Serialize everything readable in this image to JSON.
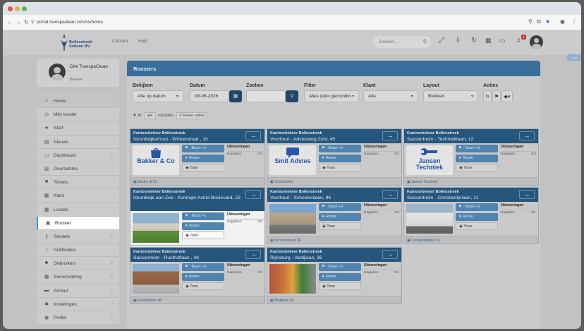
{
  "browser": {
    "url": "portal.transpaclean.nl/cms/home"
  },
  "topnav": {
    "logo_text": "Bollenstreek Schoon BV.",
    "links": [
      "Contact",
      "Help"
    ],
    "search_placeholder": "Zoeken...",
    "notification_count": "1"
  },
  "profile": {
    "name": "Dirk TranspaClean",
    "role": "Beheer"
  },
  "menu": [
    {
      "label": "Home",
      "icon": "home-icon",
      "chevron": false
    },
    {
      "label": "Mijn locatie",
      "icon": "globe-icon",
      "chevron": false
    },
    {
      "label": "Start",
      "icon": "star-icon",
      "chevron": false
    },
    {
      "label": "Nieuws",
      "icon": "news-icon",
      "chevron": false
    },
    {
      "label": "Dashboard",
      "icon": "chart-icon",
      "chevron": true
    },
    {
      "label": "Overzichten",
      "icon": "document-icon",
      "chevron": true
    },
    {
      "label": "Tickets",
      "icon": "chat-icon",
      "chevron": false
    },
    {
      "label": "Klant",
      "icon": "building-icon",
      "chevron": false
    },
    {
      "label": "Locatie",
      "icon": "building-icon",
      "chevron": false
    },
    {
      "label": "Rooster",
      "icon": "calendar-icon",
      "chevron": false
    },
    {
      "label": "Sleutels",
      "icon": "key-icon",
      "chevron": true
    },
    {
      "label": "Notificaties",
      "icon": "bell-icon",
      "chevron": false
    },
    {
      "label": "Gebruikers",
      "icon": "users-icon",
      "chevron": true
    },
    {
      "label": "Samenvatting",
      "icon": "summary-icon",
      "chevron": true
    },
    {
      "label": "Archief",
      "icon": "archive-icon",
      "chevron": true
    },
    {
      "label": "Instellingen",
      "icon": "gear-icon",
      "chevron": true
    },
    {
      "label": "Profiel",
      "icon": "user-icon",
      "chevron": true
    }
  ],
  "panel": {
    "title": "Roosters",
    "filters": {
      "bekijken_label": "Bekijken",
      "bekijken_value": "Alle op datum",
      "datum_label": "Datum",
      "datum_value": "08-06-2026",
      "zoeken_label": "Zoeken",
      "zoeken_placeholder": "...",
      "filter_label": "Filter",
      "filter_value": "Alles (slim gecombineerd)",
      "klant_label": "Klant",
      "klant_value": "Alle",
      "layout_label": "Layout",
      "layout_value": "Blokken",
      "acties_label": "Acties"
    },
    "filterline": {
      "prefix": "in",
      "pill": "alle",
      "text": "roosters",
      "reset_label": "Reset opties"
    }
  },
  "card_labels": {
    "buurt_prefix": ": Buurt +",
    "route": "Route",
    "toon": "Toon",
    "uitvoeringen": "Uitvoeringen",
    "dagtaken": "Dagtaken"
  },
  "cards": [
    {
      "company": "Kantoorbeheer Bollenstreek",
      "address": "Noordwijkerhout - Winkelstraat , 10",
      "buurt": "1",
      "count": "0/3",
      "footer": "Bakker & Co",
      "thumb_text": "Bakker & Co"
    },
    {
      "company": "Kantoorbeheer Bollenstreek",
      "address": "Voorhout - Adviesweg Zuid, 45",
      "buurt": "1",
      "count": "0/3",
      "footer": "Smit Advies",
      "thumb_text": "Smit Advies"
    },
    {
      "company": "Kantoorbeheer Bollenstreek",
      "address": "Sassenheim - Technieklaan, 12",
      "buurt": "3",
      "count": "0/3",
      "footer": "Jansen Techniek",
      "thumb_text": "Jansen Techniek"
    },
    {
      "company": "Kantoorbeheer Bollenstreek",
      "address": "Noordwijk aan Zee - Koningin Astrid Boulevard, 22",
      "buurt": "1",
      "count": "0/2",
      "footer": "Koningin Astrid Boulevard",
      "thumb_text": ""
    },
    {
      "company": "Kantoorbeheer Bollenstreek",
      "address": "Voorhout - Schoutenlaan, 96",
      "buurt": "2",
      "count": "0/2",
      "footer": "Schoutenlaan 96",
      "thumb_text": ""
    },
    {
      "company": "Kantoorbeheer Bollenstreek",
      "address": "Sassenheim - Constantijnlaan, 11",
      "buurt": "2",
      "count": "0/1",
      "footer": "Constantijnlaan 11",
      "thumb_text": ""
    },
    {
      "company": "Kantoorbeheer Bollenstreek",
      "address": "Sassenheim - Rusthoflaan , 48",
      "buurt": "2",
      "count": "0/1",
      "footer": "Rusthoflaan 48",
      "thumb_text": ""
    },
    {
      "company": "Kantoorbeheer Bollenstreek",
      "address": "Rijnsburg - Abdijlaan, 36",
      "buurt": "1",
      "count": "0/1",
      "footer": "Abdijlaan 36",
      "thumb_text": ""
    }
  ],
  "colors": {
    "header_blue": "#3a6e9b",
    "card_header": "#26567c",
    "action_blue": "#4f83b0",
    "accent": "#4a90d9"
  }
}
